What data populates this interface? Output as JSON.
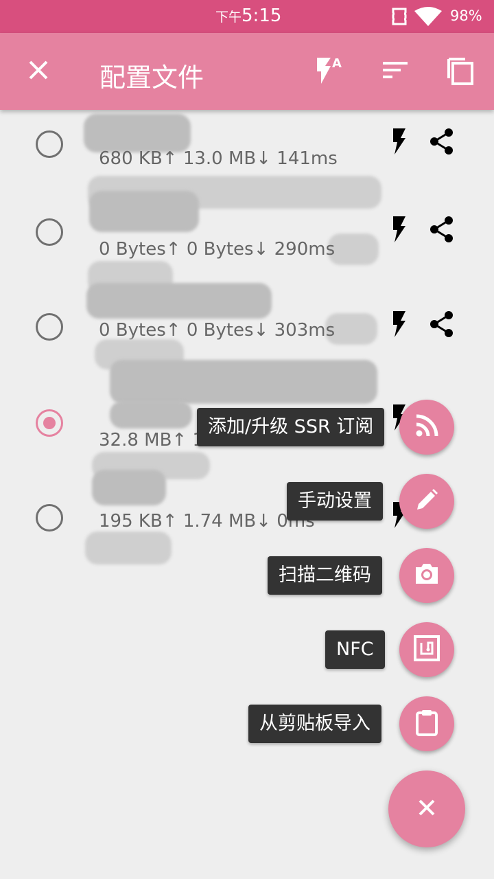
{
  "status_bar": {
    "ampm": "下午",
    "time": "5:15",
    "battery": "98%"
  },
  "toolbar": {
    "title": "配置文件"
  },
  "profiles": [
    {
      "stats": "680 KB↑ 13.0 MB↓  141ms",
      "selected": false
    },
    {
      "stats": "0 Bytes↑ 0 Bytes↓ 290ms",
      "selected": false
    },
    {
      "stats": "0 Bytes↑ 0 Bytes↓ 303ms",
      "selected": false
    },
    {
      "stats": "32.8 MB↑  161 MB↓  85ms",
      "selected": true
    },
    {
      "stats": "195 KB↑ 1.74 MB↓  0ms",
      "selected": false
    }
  ],
  "fab_menu": {
    "subscription_label": "添加/升级 SSR 订阅",
    "manual_label": "手动设置",
    "scan_label": "扫描二维码",
    "nfc_label": "NFC",
    "clipboard_label": "从剪贴板导入"
  },
  "colors": {
    "accent": "#e582a0",
    "status_bar": "#d84f7e"
  }
}
